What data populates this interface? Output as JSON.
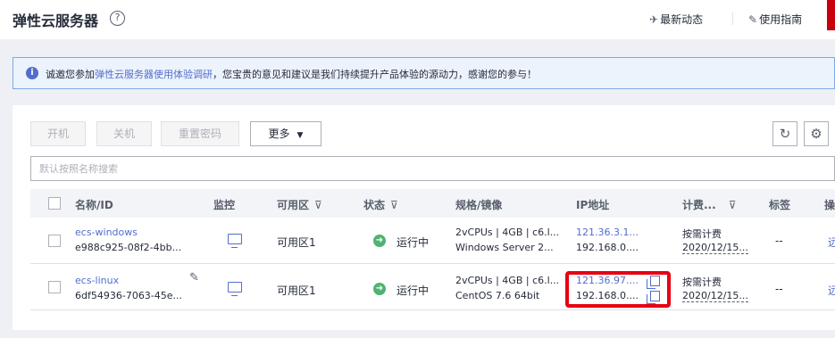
{
  "header": {
    "title": "弹性云服务器",
    "help_glyph": "?",
    "latest_news": "最新动态",
    "user_guide": "使用指南",
    "news_icon": "send-icon",
    "guide_icon": "edit-doc-icon"
  },
  "notice": {
    "prefix": "诚邀您参加",
    "link_text": "弹性云服务器使用体验调研",
    "suffix": "，您宝贵的意见和建议是我们持续提升产品体验的源动力，感谢您的参与！"
  },
  "toolbar": {
    "power_on": "开机",
    "power_off": "关机",
    "reset_password": "重置密码",
    "more": "更多",
    "refresh_icon": "refresh-icon",
    "settings_icon": "gear-icon"
  },
  "search": {
    "placeholder": "默认按照名称搜索"
  },
  "table": {
    "columns": {
      "name": "名称/ID",
      "monitor": "监控",
      "az": "可用区",
      "status": "状态",
      "spec": "规格/镜像",
      "ip": "IP地址",
      "billing": "计费...",
      "tags": "标签",
      "ops": "操"
    },
    "rows": [
      {
        "name": "ecs-windows",
        "id": "e988c925-08f2-4bb...",
        "az": "可用区1",
        "status": "运行中",
        "spec": "2vCPUs | 4GB | c6.l...",
        "image": "Windows Server 2...",
        "ip_public": "121.36.3.1...",
        "ip_private": "192.168.0....",
        "billing_mode": "按需计费",
        "billing_date": "2020/12/15...",
        "tags": "--",
        "op": "远"
      },
      {
        "name": "ecs-linux",
        "id": "6df54936-7063-45e...",
        "az": "可用区1",
        "status": "运行中",
        "spec": "2vCPUs | 4GB | c6.l...",
        "image": "CentOS 7.6 64bit",
        "ip_public": "121.36.97....",
        "ip_private": "192.168.0....",
        "billing_mode": "按需计费",
        "billing_date": "2020/12/15...",
        "tags": "--",
        "op": "远"
      }
    ]
  },
  "colors": {
    "brand_red": "#c7000b",
    "link_blue": "#526ecc",
    "status_green": "#50b371",
    "highlight_red": "#e60012"
  }
}
